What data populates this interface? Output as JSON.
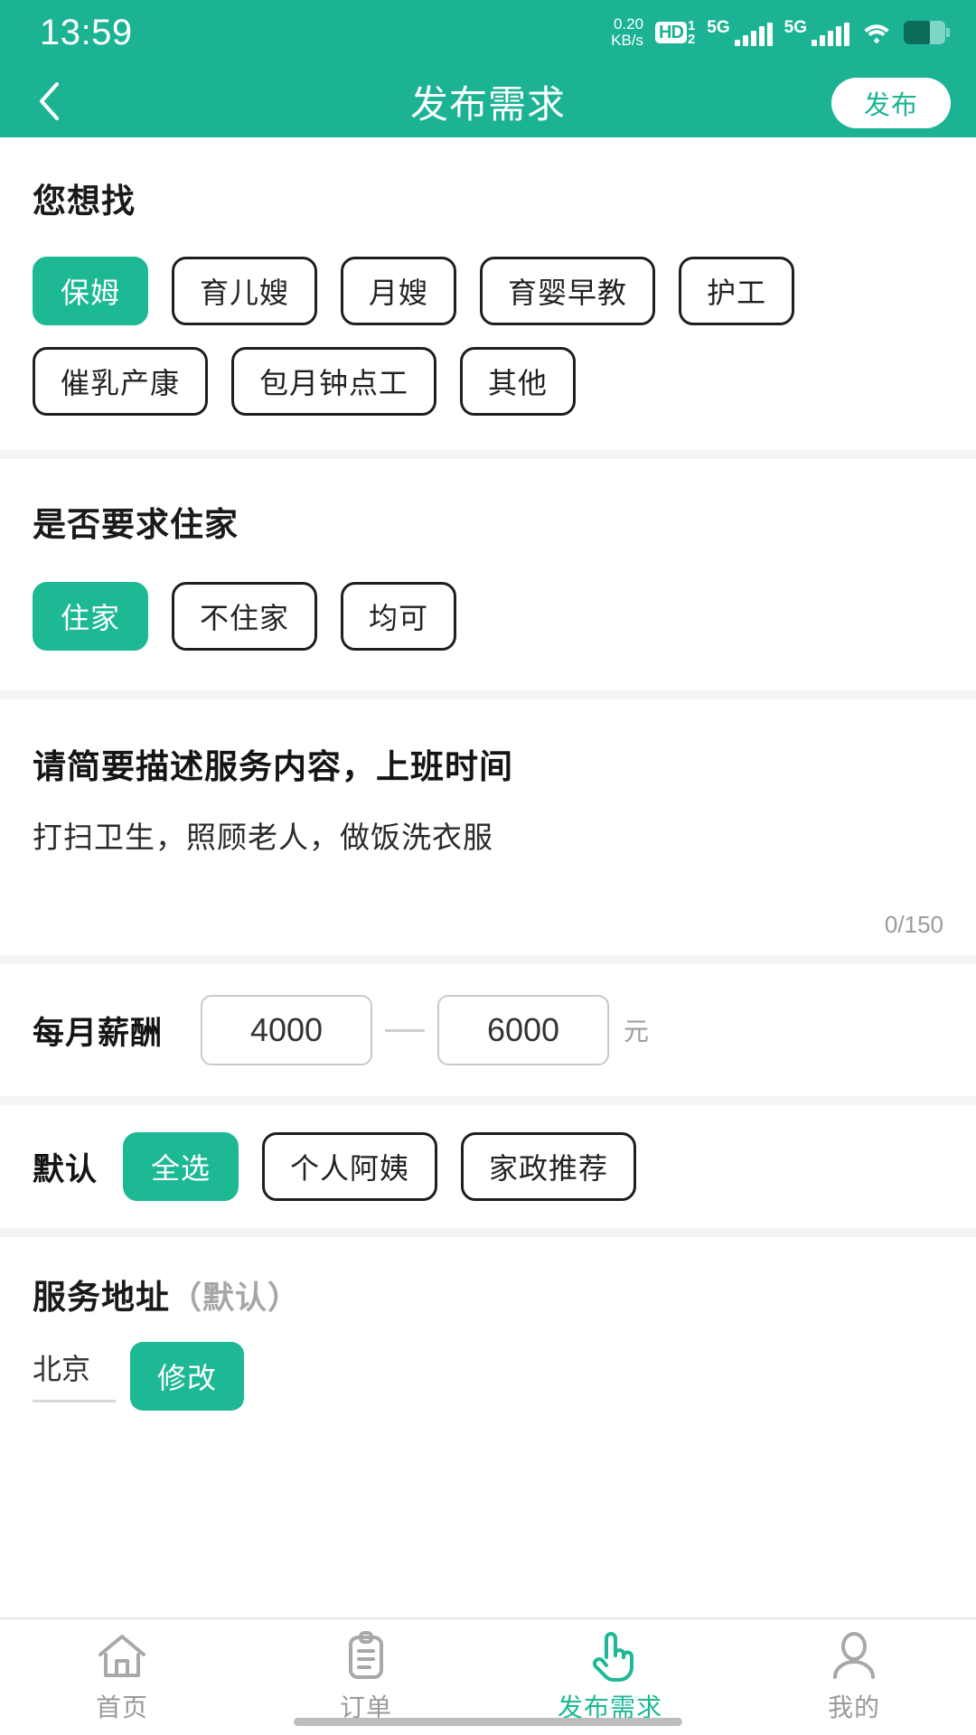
{
  "theme": {
    "primary": "#1DB894",
    "header_bg": "#1BB394",
    "divider": "#f4f4f4"
  },
  "status_bar": {
    "time": "13:59",
    "net_speed_value": "0.20",
    "net_speed_unit": "KB/s",
    "hd_label": "HD",
    "sim1": "1",
    "sim2": "2",
    "network_1": "5G",
    "network_2": "5G",
    "wifi_icon": "wifi-icon",
    "battery_icon": "battery-icon"
  },
  "header": {
    "back_icon": "chevron-left-icon",
    "title": "发布需求",
    "publish_label": "发布"
  },
  "want": {
    "title": "您想找",
    "options": [
      {
        "label": "保姆",
        "selected": true
      },
      {
        "label": "育儿嫂",
        "selected": false
      },
      {
        "label": "月嫂",
        "selected": false
      },
      {
        "label": "育婴早教",
        "selected": false
      },
      {
        "label": "护工",
        "selected": false
      },
      {
        "label": "催乳产康",
        "selected": false
      },
      {
        "label": "包月钟点工",
        "selected": false
      },
      {
        "label": "其他",
        "selected": false
      }
    ]
  },
  "live_in": {
    "title": "是否要求住家",
    "options": [
      {
        "label": "住家",
        "selected": true
      },
      {
        "label": "不住家",
        "selected": false
      },
      {
        "label": "均可",
        "selected": false
      }
    ]
  },
  "description": {
    "title": "请简要描述服务内容，上班时间",
    "placeholder": "打扫卫生，照顾老人，做饭洗衣服",
    "value": "",
    "counter": "0/150"
  },
  "salary": {
    "label": "每月薪酬",
    "min_value": "4000",
    "min_placeholder": "4000",
    "max_value": "6000",
    "max_placeholder": "6000",
    "separator": "—",
    "unit": "元"
  },
  "source": {
    "label": "默认",
    "options": [
      {
        "label": "全选",
        "selected": true
      },
      {
        "label": "个人阿姨",
        "selected": false
      },
      {
        "label": "家政推荐",
        "selected": false
      }
    ]
  },
  "address": {
    "title": "服务地址",
    "subtitle": "（默认）",
    "city_value": "北京",
    "city_placeholder": "北京",
    "edit_label": "修改"
  },
  "tabbar": {
    "items": [
      {
        "label": "首页",
        "icon": "home-icon",
        "active": false
      },
      {
        "label": "订单",
        "icon": "clipboard-icon",
        "active": false
      },
      {
        "label": "发布需求",
        "icon": "hand-tap-icon",
        "active": true
      },
      {
        "label": "我的",
        "icon": "person-icon",
        "active": false
      }
    ]
  }
}
